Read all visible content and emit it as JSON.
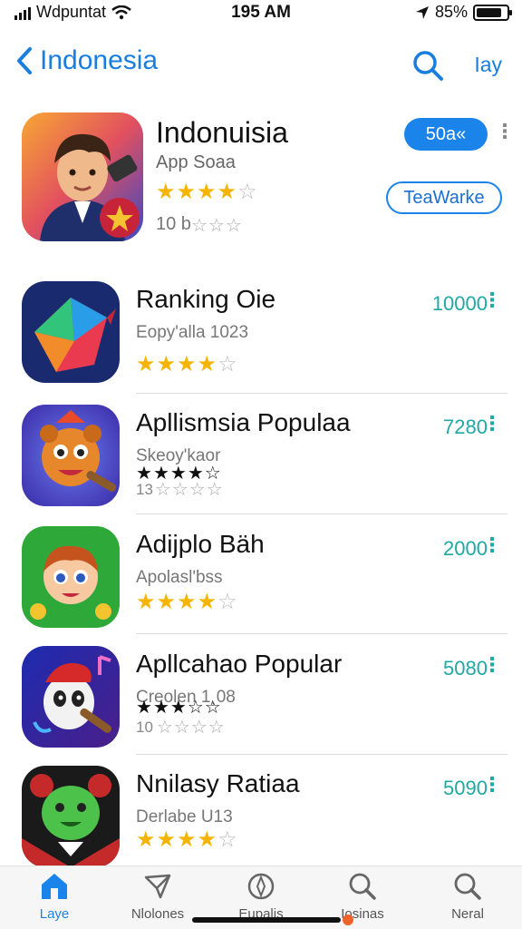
{
  "status_bar": {
    "carrier": "Wdpuntat",
    "time": "195 AM",
    "battery": "85%",
    "battery_level": 0.85
  },
  "nav": {
    "back_label": "Indonesia",
    "right_label": "Iay"
  },
  "featured": {
    "title": "Indonuisia",
    "subtitle": "App Soaa",
    "rating": 4,
    "rating_count": "10 b",
    "get_button": "50a«",
    "secondary_button": "TeaWarke"
  },
  "apps": [
    {
      "name": "Ranking Oie",
      "category": "Eopy'alla 1023",
      "rating": 4,
      "count": "",
      "value": "10000",
      "icon": "colorful-cube-icon"
    },
    {
      "name": "Apllismsia Populaa",
      "category": "Skeoy'kaor",
      "rating": 4,
      "count": "13",
      "value": "7280",
      "icon": "cartoon-bear-icon"
    },
    {
      "name": "Adijplo Bäh",
      "category": "Apolasl'bss",
      "rating": 4,
      "count": "",
      "value": "2000",
      "icon": "cartoon-boy-icon"
    },
    {
      "name": "Apllcahao Popular",
      "category": "Creolen 1¸08",
      "rating": 3,
      "count": "10",
      "value": "5080",
      "icon": "cartoon-panda-icon"
    },
    {
      "name": "Nnilasy Ratiaa",
      "category": "Derlabe U13",
      "rating": 4,
      "count": "",
      "value": "5090",
      "icon": "green-bear-icon"
    }
  ],
  "tabs": [
    {
      "label": "Laye",
      "icon": "home-icon"
    },
    {
      "label": "Nlolones",
      "icon": "send-icon"
    },
    {
      "label": "Eupalis",
      "icon": "compass-icon"
    },
    {
      "label": "Iosinas",
      "icon": "search-icon"
    },
    {
      "label": "Neral",
      "icon": "search-icon"
    }
  ],
  "colors": {
    "accent": "#1b84ea",
    "value_teal": "#1fa8a4",
    "star": "#f4b400"
  }
}
